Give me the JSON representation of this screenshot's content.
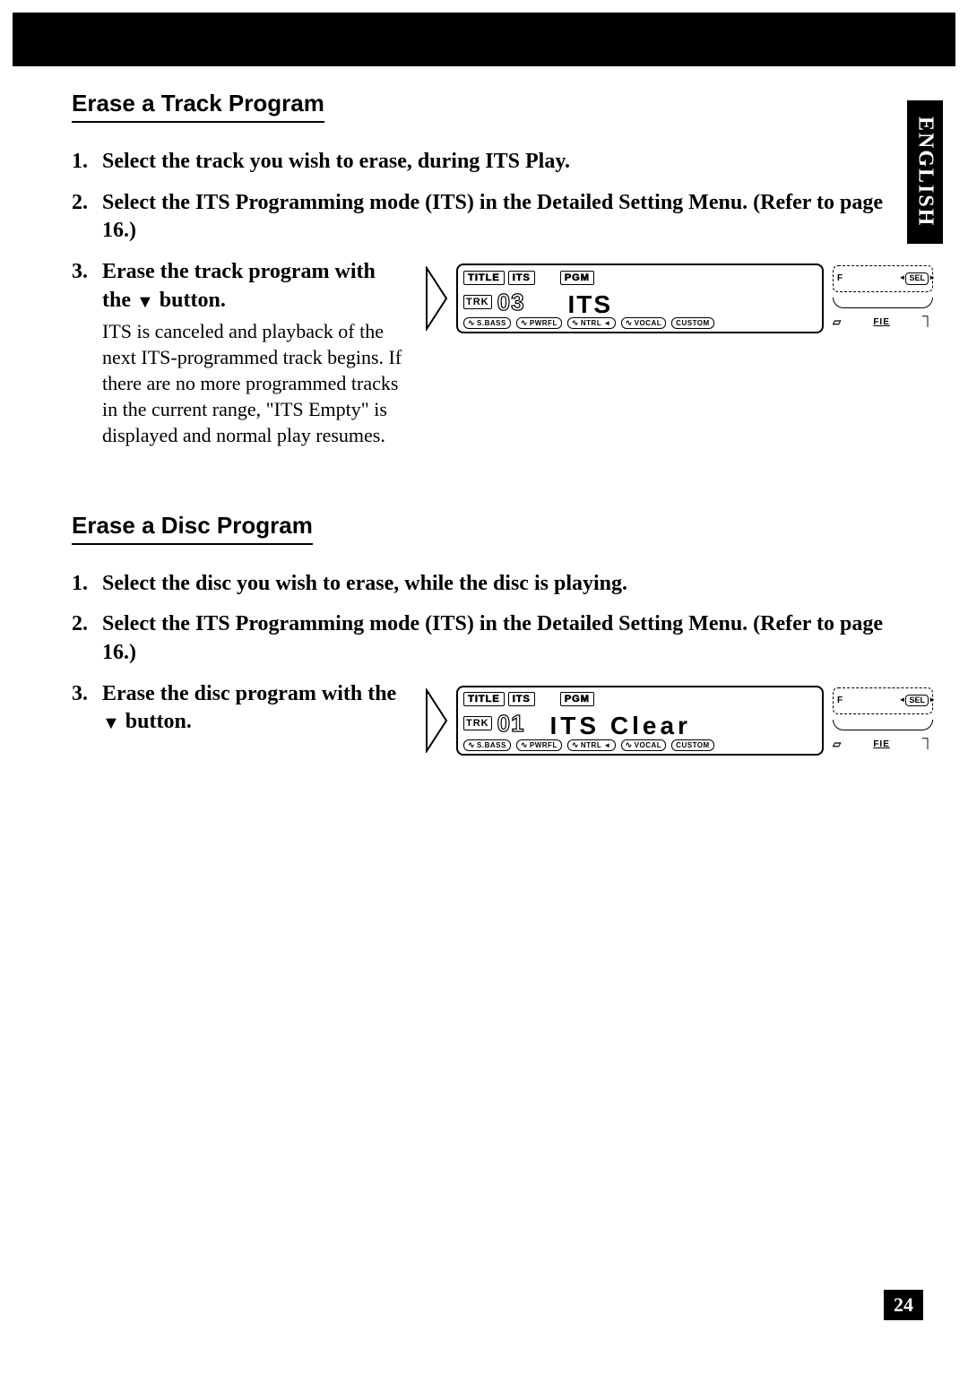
{
  "language_tab": "ENGLISH",
  "page_number": "24",
  "section1": {
    "title": "Erase a Track Program",
    "steps": [
      {
        "head": "Select the track you wish to erase, during ITS Play."
      },
      {
        "head": "Select the ITS Programming mode (ITS) in the Detailed Setting Menu. (Refer to page 16.)"
      },
      {
        "head_a": "Erase the track program with the ",
        "down_arrow": "▼",
        "head_b": " button.",
        "body": "ITS is canceled and playback of the next ITS-programmed track begins. If there are no more programmed tracks in the current range, \"ITS Empty\" is displayed and normal play resumes."
      }
    ],
    "lcd": {
      "tags": {
        "title": "TITLE",
        "its": "ITS",
        "pgm": "PGM"
      },
      "trk_label": "TRK",
      "trk_num": "03",
      "big_text": "ITS",
      "chips": {
        "sbass": "S.BASS",
        "pwrfl": "PWRFL",
        "ntrl": "NTRL",
        "vocal": "VOCAL",
        "custom": "CUSTOM"
      },
      "right": {
        "f": "F",
        "sel": "SEL",
        "fie": "FIE"
      }
    }
  },
  "section2": {
    "title": "Erase a Disc Program",
    "steps": [
      {
        "head": "Select the disc you wish to erase, while the disc is playing."
      },
      {
        "head": "Select the ITS Programming mode (ITS) in the Detailed Setting Menu. (Refer to page 16.)"
      },
      {
        "head_a": "Erase the disc program with the ",
        "down_arrow": "▼",
        "head_b": " button."
      }
    ],
    "lcd": {
      "tags": {
        "title": "TITLE",
        "its": "ITS",
        "pgm": "PGM"
      },
      "trk_label": "TRK",
      "trk_num": "01",
      "big_text": "ITS Clear",
      "chips": {
        "sbass": "S.BASS",
        "pwrfl": "PWRFL",
        "ntrl": "NTRL",
        "vocal": "VOCAL",
        "custom": "CUSTOM"
      },
      "right": {
        "f": "F",
        "sel": "SEL",
        "fie": "FIE"
      }
    }
  }
}
